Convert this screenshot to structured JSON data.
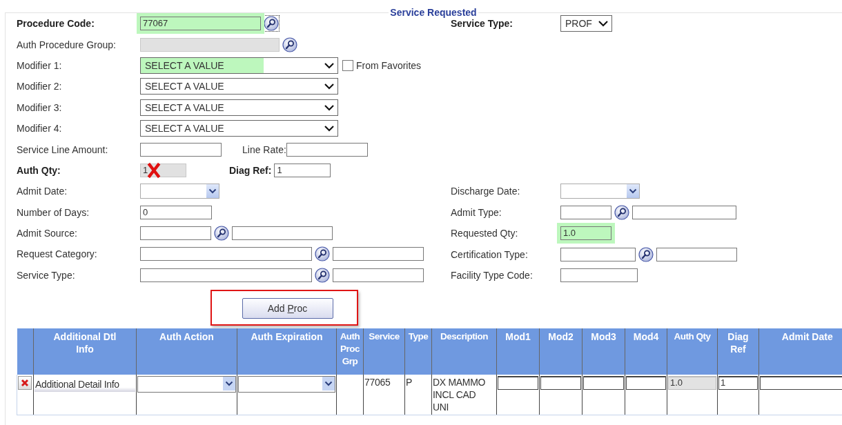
{
  "legend": "Service Requested",
  "left_fields": [
    {
      "label": "Procedure Code:",
      "bold": true,
      "kind": "lookup",
      "value": "77067",
      "highlighted": true,
      "disabled": false,
      "focused": true
    },
    {
      "label": "Auth Procedure Group:",
      "bold": false,
      "kind": "lookup",
      "highlighted": false,
      "disabled": true,
      "focused": false
    },
    {
      "label": "Modifier 1:",
      "bold": false,
      "kind": "select",
      "value": "SELECT A VALUE",
      "highlighted": true,
      "disabled": false,
      "favorites": {
        "label": "From Favorites",
        "checked": false
      }
    },
    {
      "label": "Modifier 2:",
      "bold": false,
      "kind": "select",
      "value": "SELECT A VALUE",
      "highlighted": false,
      "disabled": false
    },
    {
      "label": "Modifier 3:",
      "bold": false,
      "kind": "select",
      "value": "SELECT A VALUE",
      "highlighted": false,
      "disabled": false
    },
    {
      "label": "Modifier 4:",
      "bold": false,
      "kind": "select",
      "value": "SELECT A VALUE",
      "highlighted": false,
      "disabled": false
    },
    {
      "label": "Service Line Amount:",
      "bold": false,
      "kind": "pair",
      "highlighted": false,
      "disabled": false,
      "second": {
        "label": "Line Rate:",
        "bold": false
      }
    },
    {
      "label": "Auth Qty:",
      "bold": true,
      "kind": "pair",
      "value": "1",
      "highlighted": false,
      "disabled": true,
      "error": true,
      "second": {
        "label": "Diag Ref:",
        "bold": true,
        "value": "1"
      }
    },
    {
      "label": "Admit Date:",
      "bold": false,
      "kind": "date",
      "highlighted": false,
      "disabled": false
    },
    {
      "label": "Number of Days:",
      "bold": false,
      "kind": "text",
      "value": "0",
      "highlighted": false,
      "disabled": false
    },
    {
      "label": "Admit Source:",
      "bold": false,
      "kind": "lookup_desc",
      "highlighted": false,
      "disabled": false
    },
    {
      "label": "Request Category:",
      "bold": false,
      "kind": "lookup_desc",
      "highlighted": false,
      "disabled": false
    },
    {
      "label": "Service Type:",
      "bold": false,
      "kind": "lookup_desc",
      "highlighted": false,
      "disabled": false
    }
  ],
  "right_fields": [
    {
      "label": "Service Type:",
      "bold": true,
      "kind": "select",
      "value": "PROF",
      "highlighted": false,
      "disabled": false
    },
    {
      "label": "Discharge Date:",
      "bold": false,
      "kind": "date",
      "highlighted": false,
      "disabled": false
    },
    {
      "label": "Admit Type:",
      "bold": false,
      "kind": "lookup_desc",
      "highlighted": false,
      "disabled": false
    },
    {
      "label": "Requested Qty:",
      "bold": false,
      "kind": "text",
      "value": "1.0",
      "highlighted": true,
      "disabled": false
    },
    {
      "label": "Certification Type:",
      "bold": false,
      "kind": "lookup_desc",
      "highlighted": false,
      "disabled": false
    },
    {
      "label": "Facility Type Code:",
      "bold": false,
      "kind": "text",
      "highlighted": false,
      "disabled": false
    }
  ],
  "add_button": {
    "label_parts": [
      "Add ",
      "P",
      "roc"
    ],
    "highlighted": true
  },
  "table": {
    "columns": [
      "",
      "Additional Dtl Info",
      "Auth Action",
      "Auth Expiration",
      "Auth Proc Grp",
      "Service",
      "Type",
      "Description",
      "Mod1",
      "Mod2",
      "Mod3",
      "Mod4",
      "Auth Qty",
      "Diag Ref",
      "Admit Date"
    ],
    "rows": [
      {
        "cells": [
          {
            "kind": "delete"
          },
          {
            "kind": "button",
            "value": "Additional Detail Info"
          },
          {
            "kind": "dropdown"
          },
          {
            "kind": "dropdown"
          },
          {
            "kind": "empty"
          },
          {
            "kind": "text",
            "value": "77065"
          },
          {
            "kind": "text",
            "value": "P"
          },
          {
            "kind": "text",
            "value": "DX MAMMO INCL CAD UNI"
          },
          {
            "kind": "input",
            "disabled": false
          },
          {
            "kind": "input",
            "disabled": false
          },
          {
            "kind": "input",
            "disabled": false
          },
          {
            "kind": "input",
            "disabled": false
          },
          {
            "kind": "input",
            "value": "1.0",
            "disabled": true
          },
          {
            "kind": "input",
            "value": "1",
            "disabled": false
          },
          {
            "kind": "input",
            "disabled": false
          }
        ]
      }
    ]
  }
}
